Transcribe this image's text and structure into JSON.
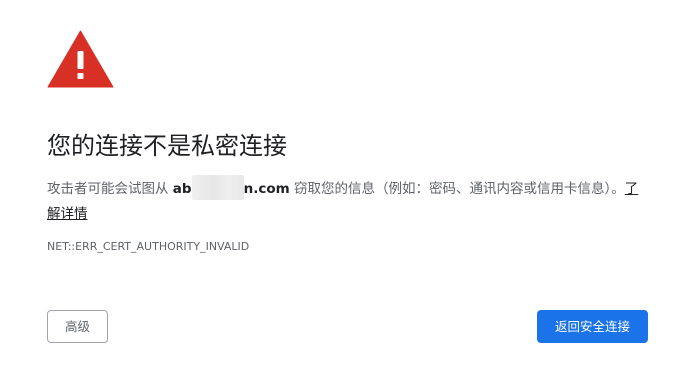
{
  "interstitial": {
    "title": "您的连接不是私密连接",
    "description_prefix": "攻击者可能会试图从 ",
    "domain_start": "ab",
    "domain_end": "n.com",
    "description_suffix": " 窃取您的信息（例如：密码、通讯内容或信用卡信息）。",
    "learn_more": "了解详情",
    "error_code": "NET::ERR_CERT_AUTHORITY_INVALID",
    "advanced_button": "高级",
    "back_button": "返回安全连接",
    "warning_icon": "warning-triangle-icon",
    "colors": {
      "warning_red": "#d93025",
      "primary_blue": "#1a73e8"
    }
  }
}
